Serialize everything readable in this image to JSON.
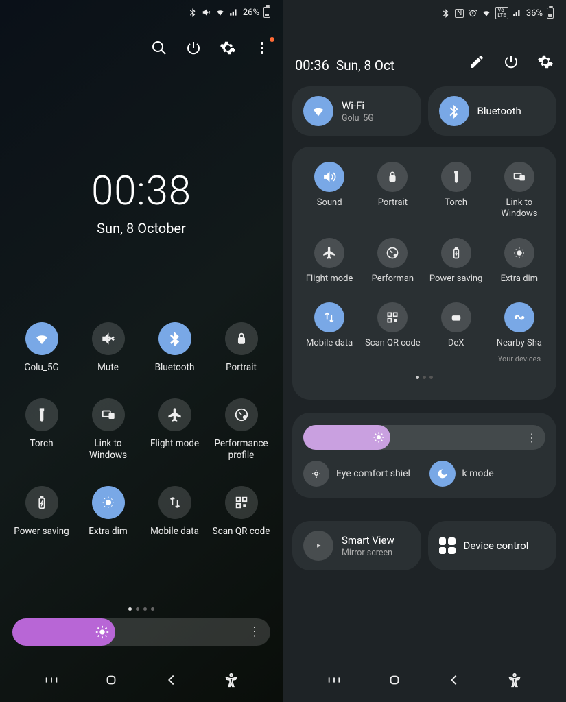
{
  "left": {
    "status": {
      "battery_pct": "26%"
    },
    "time": "00:38",
    "date": "Sun, 8 October",
    "tiles": [
      {
        "label": "Golu_5G",
        "icon": "wifi",
        "active": true
      },
      {
        "label": "Mute",
        "icon": "mute",
        "active": false
      },
      {
        "label": "Bluetooth",
        "icon": "bluetooth",
        "active": true
      },
      {
        "label": "Portrait",
        "icon": "lock",
        "active": false
      },
      {
        "label": "Torch",
        "icon": "torch",
        "active": false
      },
      {
        "label": "Link to Windows",
        "icon": "link",
        "active": false
      },
      {
        "label": "Flight mode",
        "icon": "airplane",
        "active": false
      },
      {
        "label": "Performance profile",
        "icon": "perf",
        "active": false
      },
      {
        "label": "Power saving",
        "icon": "battery",
        "active": false
      },
      {
        "label": "Extra dim",
        "icon": "dim",
        "active": true
      },
      {
        "label": "Mobile data",
        "icon": "data",
        "active": false
      },
      {
        "label": "Scan QR code",
        "icon": "qr",
        "active": false
      }
    ],
    "brightness_pct": 40
  },
  "right": {
    "status": {
      "battery_pct": "36%"
    },
    "time": "00:36",
    "date": "Sun, 8 Oct",
    "top_tiles": [
      {
        "title": "Wi-Fi",
        "subtitle": "Golu_5G",
        "icon": "wifi",
        "active": true
      },
      {
        "title": "Bluetooth",
        "subtitle": "",
        "icon": "bluetooth",
        "active": true
      }
    ],
    "tiles": [
      {
        "label": "Sound",
        "icon": "sound",
        "active": true,
        "wrap": false
      },
      {
        "label": "Portrait",
        "icon": "lock",
        "active": false,
        "wrap": false
      },
      {
        "label": "Torch",
        "icon": "torch",
        "active": false,
        "wrap": false
      },
      {
        "label": "Link to Windows",
        "icon": "link",
        "active": false,
        "wrap": true
      },
      {
        "label": "Flight mode",
        "icon": "airplane",
        "active": false,
        "wrap": true
      },
      {
        "label": "Performan",
        "icon": "perf",
        "active": false,
        "wrap": false
      },
      {
        "label": "Power saving",
        "icon": "battery",
        "active": false,
        "wrap": true
      },
      {
        "label": "Extra dim",
        "icon": "dim",
        "active": false,
        "wrap": false
      },
      {
        "label": "Mobile data",
        "icon": "data",
        "active": true,
        "wrap": true
      },
      {
        "label": "Scan QR code",
        "icon": "qr",
        "active": false,
        "wrap": true
      },
      {
        "label": "DeX",
        "icon": "dex",
        "active": false,
        "wrap": false
      },
      {
        "label": "Nearby Sha",
        "sub": "Your devices",
        "icon": "nearby",
        "active": true,
        "wrap": false
      }
    ],
    "brightness_pct": 36,
    "toggles": [
      {
        "label": "Eye comfort shiel",
        "icon": "eye",
        "active": false
      },
      {
        "label": "k mode",
        "icon": "moon",
        "active": true
      }
    ],
    "bottom_tiles": [
      {
        "title": "Smart View",
        "subtitle": "Mirror screen",
        "icon": "cast"
      },
      {
        "title": "Device control",
        "subtitle": "",
        "icon": "grid"
      }
    ]
  }
}
